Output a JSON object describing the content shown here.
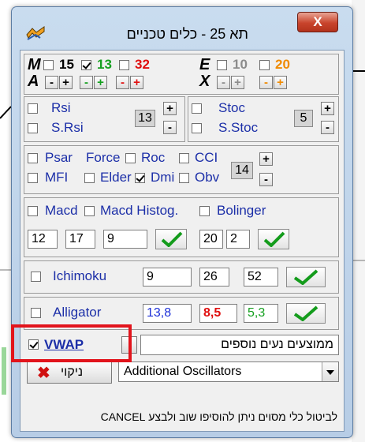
{
  "window": {
    "title": "תא 25 - כלים טכניים",
    "close_label": "X"
  },
  "ma": {
    "m_label": "M",
    "e_label": "E",
    "a_label": "A",
    "x_label": "X",
    "periods": [
      {
        "value": "15",
        "checked": false,
        "color": "#000000"
      },
      {
        "value": "13",
        "checked": true,
        "color": "#15a020"
      },
      {
        "value": "32",
        "checked": false,
        "color": "#e01010"
      },
      {
        "value": "10",
        "checked": false,
        "color": "#8c8c8c"
      },
      {
        "value": "20",
        "checked": false,
        "color": "#f08a00"
      }
    ],
    "minus": "-",
    "plus": "+"
  },
  "rsi": {
    "rsi_label": "Rsi",
    "srsi_label": "S.Rsi",
    "period": "13"
  },
  "stoc": {
    "stoc_label": "Stoc",
    "sstoc_label": "S.Stoc",
    "period": "5"
  },
  "osc": {
    "psar": "Psar",
    "force": "Force",
    "roc": "Roc",
    "cci": "CCI",
    "mfi": "MFI",
    "elder": "Elder",
    "dmi": "Dmi",
    "obv": "Obv",
    "period": "14"
  },
  "macd": {
    "macd_label": "Macd",
    "histog_label": "Macd Histog.",
    "v1": "12",
    "v2": "17",
    "v3": "9"
  },
  "bolinger": {
    "label": "Bolinger",
    "v1": "20",
    "v2": "2"
  },
  "ichimoku": {
    "label": "Ichimoku",
    "v1": "9",
    "v2": "26",
    "v3": "52"
  },
  "alligator": {
    "label": "Alligator",
    "v1": "13,8",
    "v2": "8,5",
    "v3": "5,3",
    "colors": {
      "v1": "#1c2fd8",
      "v2": "#e01010",
      "v3": "#15a020"
    }
  },
  "vwap": {
    "label": "VWAP",
    "checked": true,
    "combo_value": "ממוצעים נעים נוספים"
  },
  "clear": {
    "label": "ניקוי"
  },
  "additional": {
    "combo_value": "Additional Oscillators"
  },
  "footer": {
    "text": "לביטול כלי מסוים ניתן להוסיפו שוב ולבצע CANCEL"
  },
  "accent": {
    "highlight": "#e2141c",
    "chart_bar": "#9ad79a"
  }
}
